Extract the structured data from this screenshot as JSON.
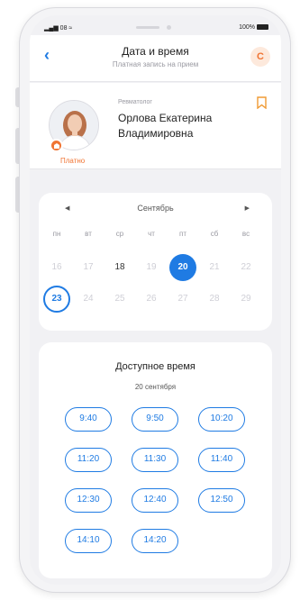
{
  "status_bar": {
    "carrier": "08",
    "battery": "100%"
  },
  "header": {
    "back_icon": "chevron-left-icon",
    "title": "Дата и время",
    "subtitle": "Платная запись на прием",
    "badge": "С"
  },
  "doctor": {
    "specialty": "Ревматолог",
    "name": "Орлова Екатерина Владимировна",
    "paid_label": "Платно",
    "bookmark_icon": "bookmark-icon"
  },
  "calendar": {
    "month": "Сентябрь",
    "weekdays": [
      "пн",
      "вт",
      "ср",
      "чт",
      "пт",
      "сб",
      "вс"
    ],
    "rows": [
      [
        "16",
        "17",
        "18",
        "19",
        "20",
        "21",
        "22"
      ],
      [
        "23",
        "24",
        "25",
        "26",
        "27",
        "28",
        "29"
      ]
    ],
    "selected_day": "20",
    "today_day": "23",
    "available_days": [
      "18",
      "20",
      "23"
    ]
  },
  "availability": {
    "title": "Доступное время",
    "date": "20 сентября",
    "slots": [
      "9:40",
      "9:50",
      "10:20",
      "11:20",
      "11:30",
      "11:40",
      "12:30",
      "12:40",
      "12:50",
      "14:10",
      "14:20"
    ]
  },
  "colors": {
    "accent": "#1f7be3",
    "paid": "#f07433"
  }
}
